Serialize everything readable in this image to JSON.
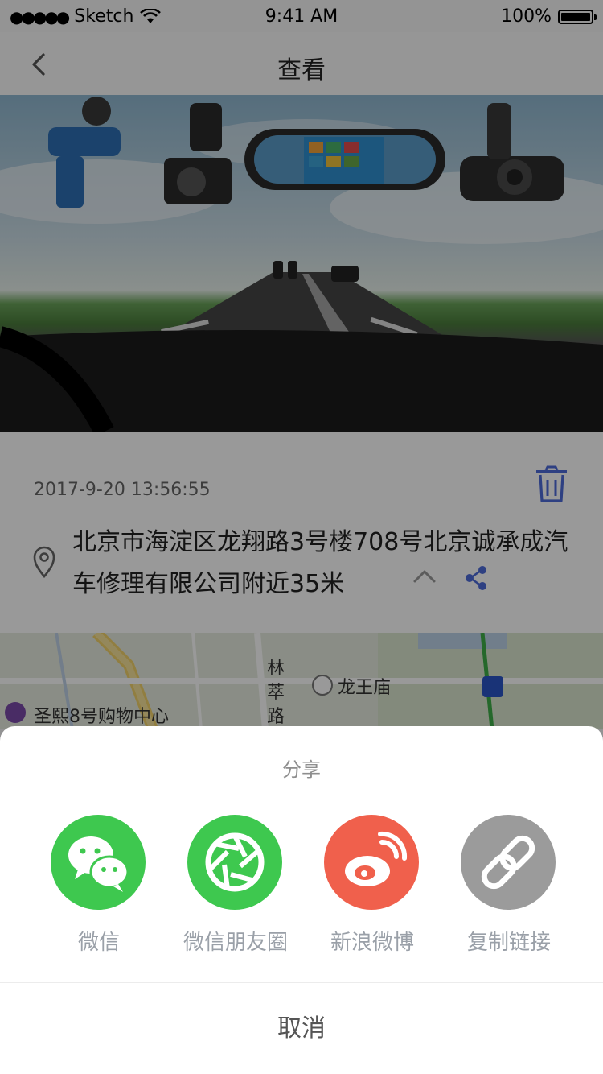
{
  "status_bar": {
    "signal": "●●●●●",
    "carrier": "Sketch",
    "time": "9:41 AM",
    "battery_text": "100%",
    "battery_level": 1.0
  },
  "nav": {
    "title": "查看",
    "back_icon": "chevron-left-icon"
  },
  "record": {
    "datetime": "2017-9-20  13:56:55",
    "address": "北京市海淀区龙翔路3号楼708号北京诚承成汽车修理有限公司附近35米",
    "delete_icon": "trash-icon",
    "location_icon": "location-pin-icon",
    "collapse_icon": "chevron-up-icon",
    "share_icon": "share-icon"
  },
  "map": {
    "labels": {
      "road": "林\n萃\n路",
      "temple": "龙王庙",
      "mall": "圣熙8号购物中心"
    }
  },
  "share_sheet": {
    "title": "分享",
    "items": [
      {
        "label": "微信",
        "icon": "wechat-icon",
        "color": "#3ec84f"
      },
      {
        "label": "微信朋友圈",
        "icon": "moments-icon",
        "color": "#3ec84f"
      },
      {
        "label": "新浪微博",
        "icon": "weibo-icon",
        "color": "#f0604c"
      },
      {
        "label": "复制链接",
        "icon": "link-icon",
        "color": "#9b9b9b"
      }
    ],
    "cancel_label": "取消"
  },
  "colors": {
    "accent": "#4e6cd9",
    "overlay": "rgba(0,0,0,0.40)"
  }
}
